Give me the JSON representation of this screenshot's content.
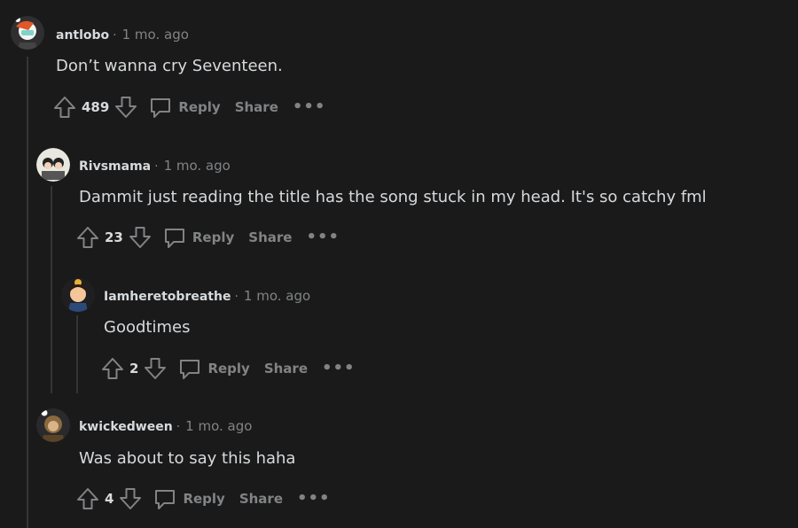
{
  "comments": [
    {
      "author": "antlobo",
      "separator": "·",
      "time": "1 mo. ago",
      "body": "Don’t wanna cry Seventeen.",
      "score": "489",
      "reply": "Reply",
      "share": "Share",
      "more": "•••"
    },
    {
      "author": "Rivsmama",
      "separator": "·",
      "time": "1 mo. ago",
      "body": "Dammit just reading the title has the song stuck in my head. It's so catchy fml",
      "score": "23",
      "reply": "Reply",
      "share": "Share",
      "more": "•••"
    },
    {
      "author": "Iamheretobreathe",
      "separator": "·",
      "time": "1 mo. ago",
      "body": "Goodtimes",
      "score": "2",
      "reply": "Reply",
      "share": "Share",
      "more": "•••"
    },
    {
      "author": "kwickedween",
      "separator": "·",
      "time": "1 mo. ago",
      "body": "Was about to say this haha",
      "score": "4",
      "reply": "Reply",
      "share": "Share",
      "more": "•••"
    }
  ],
  "colors": {
    "background": "#1a1a1b",
    "text": "#d7dadc",
    "muted": "#818384",
    "thread_line": "#343536"
  },
  "icons": [
    "upvote-icon",
    "downvote-icon",
    "reply-icon",
    "more-icon",
    "avatar"
  ]
}
